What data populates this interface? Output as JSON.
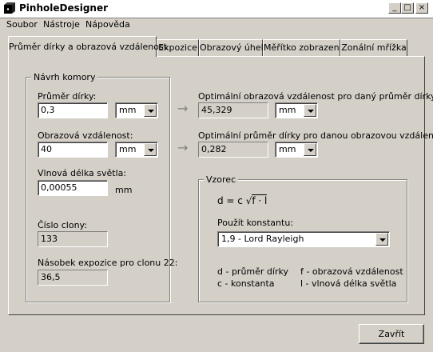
{
  "window": {
    "title": "PinholeDesigner",
    "controls": [
      "_",
      "□",
      "×"
    ]
  },
  "menu": [
    "Soubor",
    "Nástroje",
    "Nápověda"
  ],
  "tabs": [
    "Průměr dírky a obrazová vzdálenost",
    "Expozice",
    "Obrazový úhel",
    "Měřítko zobrazení",
    "Zonální mřížka"
  ],
  "design": {
    "legend": "Návrh komory",
    "diameter_label": "Průměr dírky:",
    "diameter_value": "0,3",
    "diameter_unit": "mm",
    "distance_label": "Obrazová vzdálenost:",
    "distance_value": "40",
    "distance_unit": "mm",
    "wavelength_label": "Vlnová délka světla:",
    "wavelength_value": "0,00055",
    "wavelength_unit": "mm",
    "fnumber_label": "Číslo clony:",
    "fnumber_value": "133",
    "exposure_label": "Násobek expozice pro clonu 22:",
    "exposure_value": "36,5"
  },
  "optimal": {
    "distance_label": "Optimální obrazová vzdálenost pro daný průměr dírky:",
    "distance_value": "45,329",
    "distance_unit": "mm",
    "diameter_label": "Optimální průměr dírky pro danou obrazovou vzdálenost:",
    "diameter_value": "0,282",
    "diameter_unit": "mm"
  },
  "formula": {
    "legend": "Vzorec",
    "lhs": "d = c",
    "radicand": "f · l",
    "const_label": "Použít konstantu:",
    "const_value": "1,9 - Lord Rayleigh",
    "legend_d": "d - průměr dírky",
    "legend_f": "f - obrazová vzdálenost",
    "legend_c": "c - konstanta",
    "legend_l": "l - vlnová délka světla"
  },
  "close_label": "Zavřít"
}
